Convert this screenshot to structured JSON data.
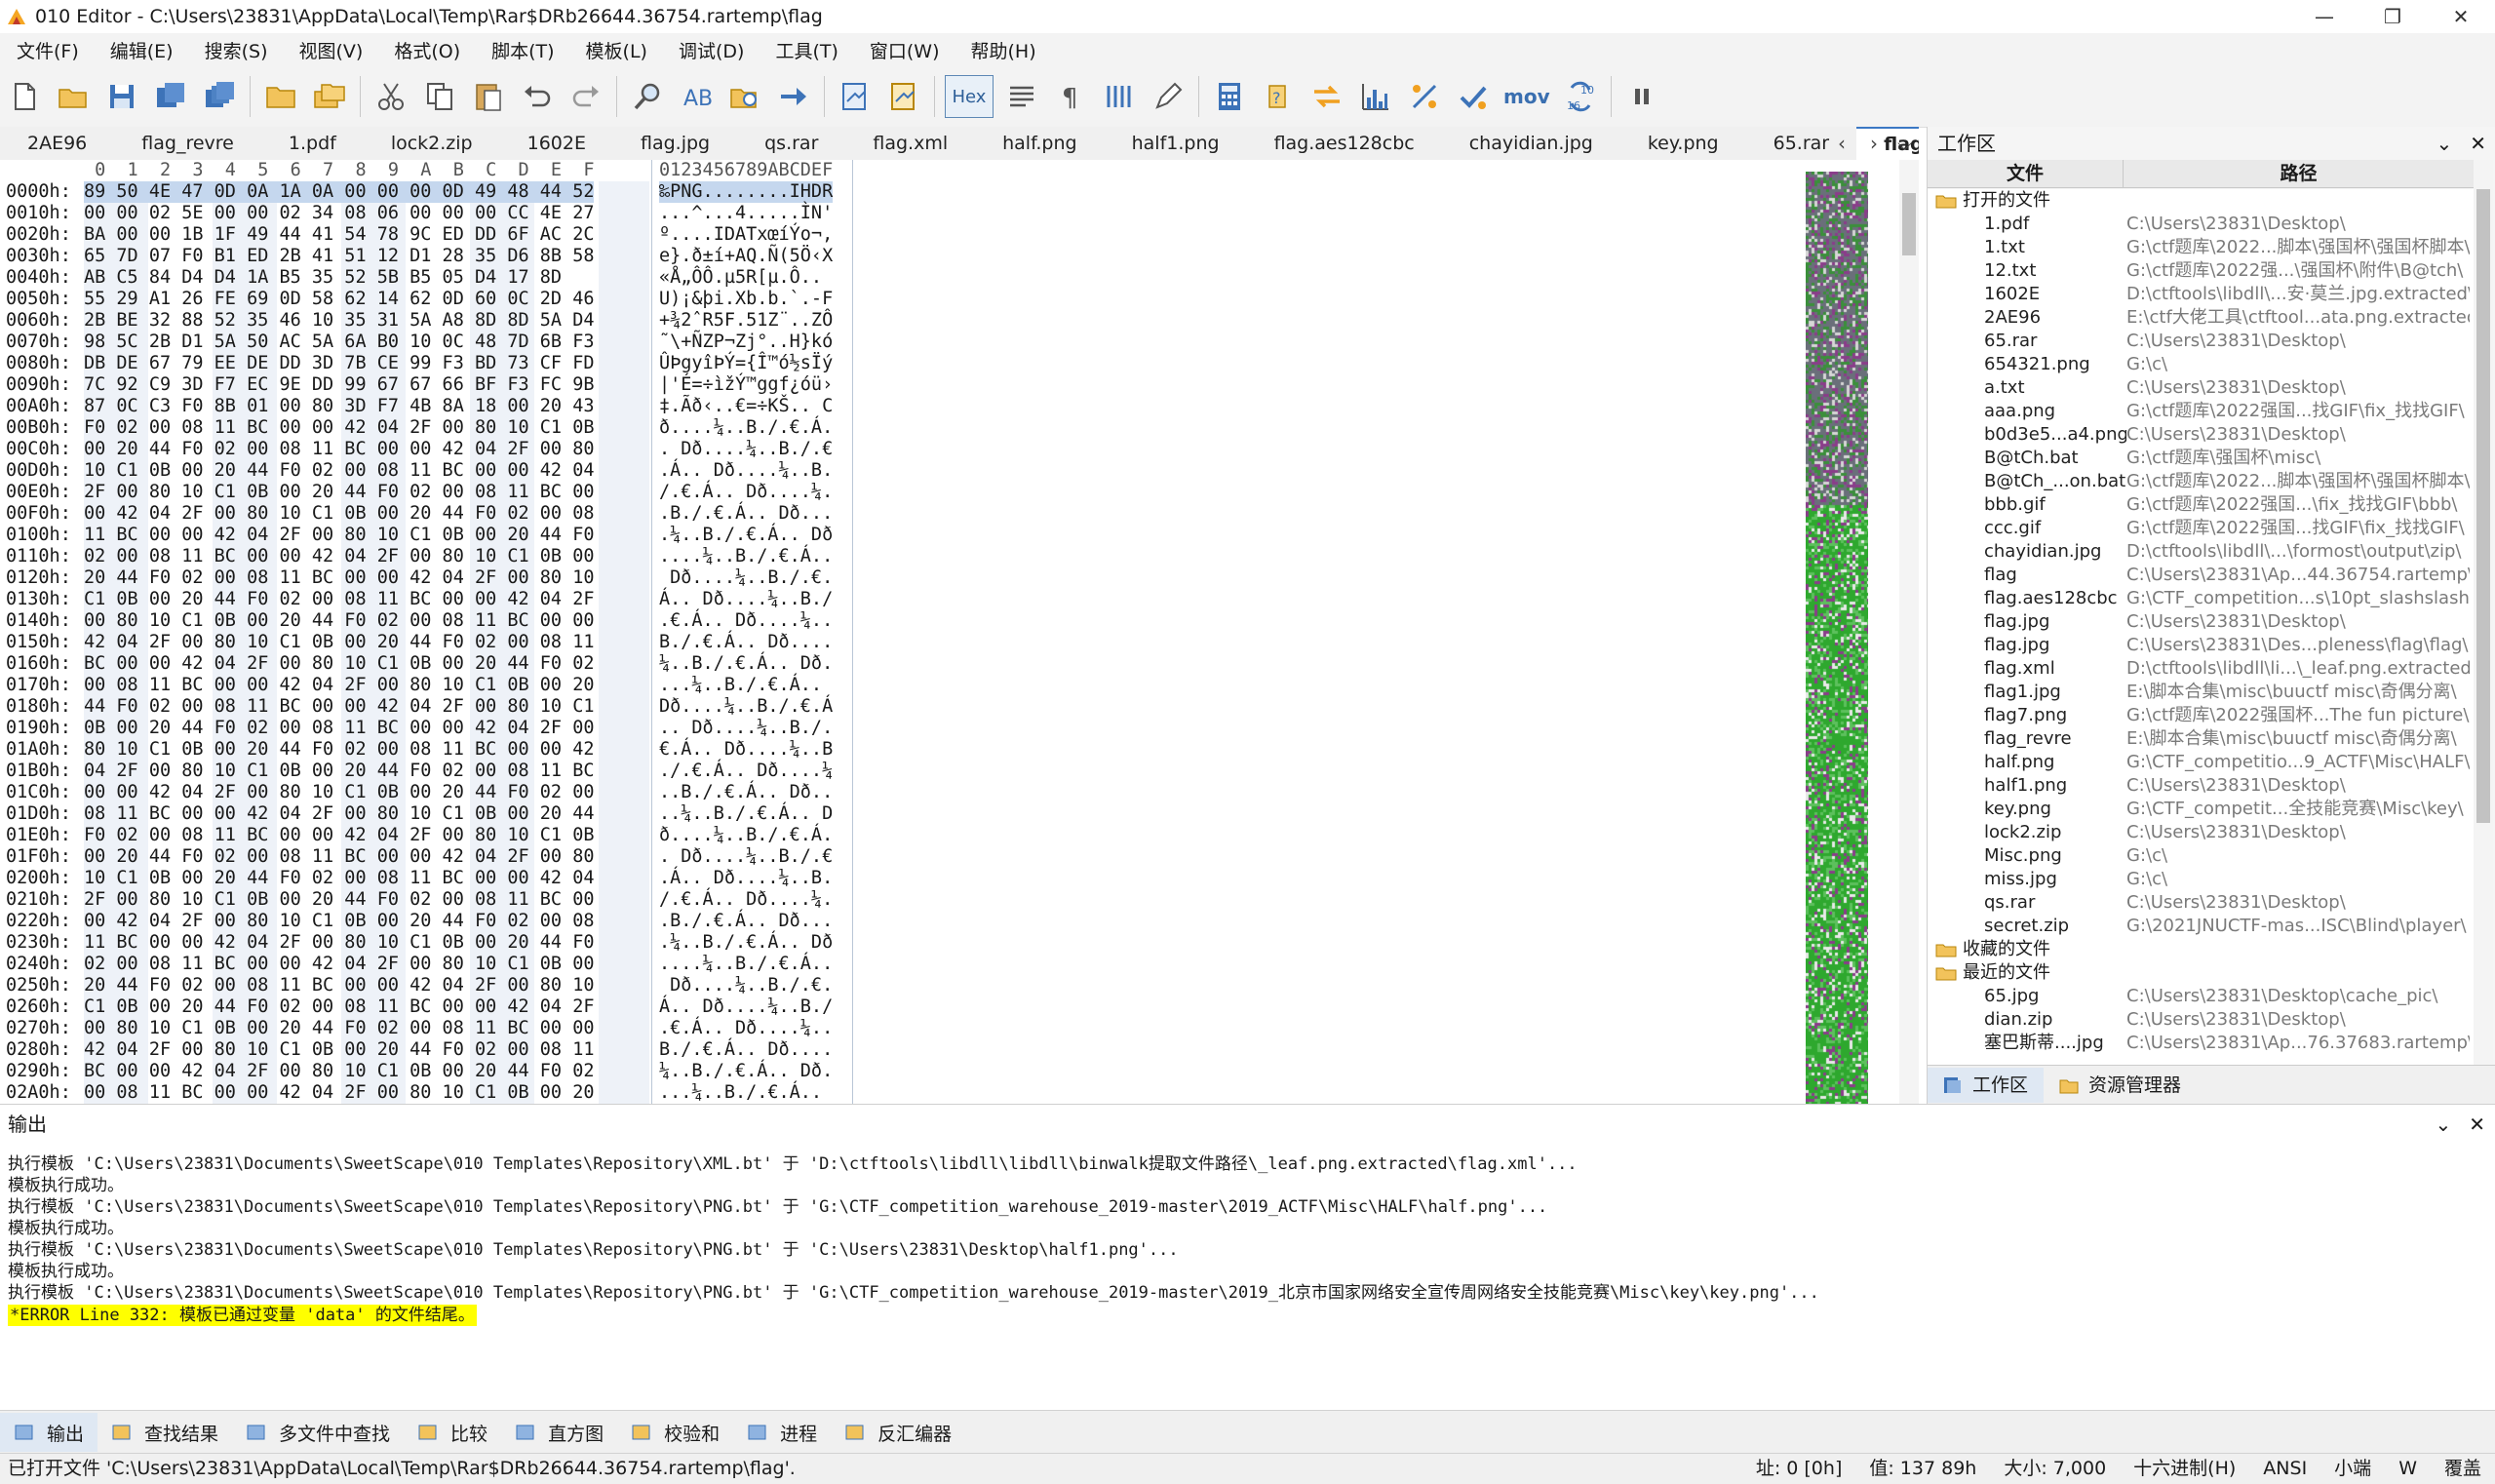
{
  "titlebar": {
    "title": "010 Editor - C:\\Users\\23831\\AppData\\Local\\Temp\\Rar$DRb26644.36754.rartemp\\flag",
    "minimize": "—",
    "maximize": "❐",
    "close": "✕"
  },
  "menu": [
    "文件(F)",
    "编辑(E)",
    "搜索(S)",
    "视图(V)",
    "格式(O)",
    "脚本(T)",
    "模板(L)",
    "调试(D)",
    "工具(T)",
    "窗口(W)",
    "帮助(H)"
  ],
  "toolbar": {
    "hex_label": "Hex",
    "mov_label": "mov",
    "b1": "10",
    "b2": "16"
  },
  "tabs": [
    "2AE96",
    "flag_revre",
    "1.pdf",
    "lock2.zip",
    "1602E",
    "flag.jpg",
    "qs.rar",
    "flag.xml",
    "half.png",
    "half1.png",
    "flag.aes128cbc",
    "chayidian.jpg",
    "key.png",
    "65.rar"
  ],
  "active_tab": {
    "label": "flag",
    "close": "✕"
  },
  "tab_nav": {
    "prev": "‹",
    "next": "›",
    "list": "⌵"
  },
  "hex": {
    "header_offset": "",
    "header_hex": " 0  1  2  3  4  5  6  7  8  9  A  B  C  D  E  F",
    "header_ascii": "0123456789ABCDEF",
    "rows": [
      {
        "off": "0000h:",
        "hex": "89 50 4E 47 0D 0A 1A 0A 00 00 00 0D 49 48 44 52",
        "asc": "‰PNG........IHDR"
      },
      {
        "off": "0010h:",
        "hex": "00 00 02 5E 00 00 02 34 08 06 00 00 00 CC 4E 27",
        "asc": "...^...4.....ÌN'"
      },
      {
        "off": "0020h:",
        "hex": "BA 00 00 1B 1F 49 44 41 54 78 9C ED DD 6F AC 2C",
        "asc": "º....IDATxœíÝo¬,"
      },
      {
        "off": "0030h:",
        "hex": "65 7D 07 F0 B1 ED 2B 41 51 12 D1 28 35 D6 8B 58",
        "asc": "e}.ð±í+AQ.Ñ(5Ö‹X"
      },
      {
        "off": "0040h:",
        "hex": "AB C5 84 D4 D4 1A B5 35 52 5B B5 05 D4 17 8D",
        "asc": "«Å„ÔÔ.µ5R[µ.Ô.."
      },
      {
        "off": "0050h:",
        "hex": "55 29 A1 26 FE 69 0D 58 62 14 62 0D 60 0C 2D 46",
        "asc": "U)¡&þi.Xb.b.`.-F"
      },
      {
        "off": "0060h:",
        "hex": "2B BE 32 88 52 35 46 10 35 31 5A A8 8D 8D 5A D4",
        "asc": "+¾2ˆR5F.51Z¨..ZÔ"
      },
      {
        "off": "0070h:",
        "hex": "98 5C 2B D1 5A 50 AC 5A 6A B0 10 0C 48 7D 6B F3",
        "asc": "˜\\+ÑZP¬Zj°..H}kó"
      },
      {
        "off": "0080h:",
        "hex": "DB DE 67 79 EE DE DD 3D 7B CE 99 F3 BD 73 CF FD",
        "asc": "ÛÞgyîÞÝ={Î™ó½sÏý"
      },
      {
        "off": "0090h:",
        "hex": "7C 92 C9 3D F7 EC 9E DD 99 67 67 66 BF F3 FC 9B",
        "asc": "|'É=÷ìžÝ™ggf¿óü›"
      },
      {
        "off": "00A0h:",
        "hex": "87 0C C3 F0 8B 01 00 80 3D F7 4B 8A 18 00 20 43",
        "asc": "‡.Ãð‹..€=÷KŠ.. C"
      },
      {
        "off": "00B0h:",
        "hex": "F0 02 00 08 11 BC 00 00 42 04 2F 00 80 10 C1 0B",
        "asc": "ð....¼..B./.€.Á."
      },
      {
        "off": "00C0h:",
        "hex": "00 20 44 F0 02 00 08 11 BC 00 00 42 04 2F 00 80",
        "asc": ". Dð....¼..B./.€"
      },
      {
        "off": "00D0h:",
        "hex": "10 C1 0B 00 20 44 F0 02 00 08 11 BC 00 00 42 04",
        "asc": ".Á.. Dð....¼..B."
      },
      {
        "off": "00E0h:",
        "hex": "2F 00 80 10 C1 0B 00 20 44 F0 02 00 08 11 BC 00",
        "asc": "/.€.Á.. Dð....¼."
      },
      {
        "off": "00F0h:",
        "hex": "00 42 04 2F 00 80 10 C1 0B 00 20 44 F0 02 00 08",
        "asc": ".B./.€.Á.. Dð..."
      },
      {
        "off": "0100h:",
        "hex": "11 BC 00 00 42 04 2F 00 80 10 C1 0B 00 20 44 F0",
        "asc": ".¼..B./.€.Á.. Dð"
      },
      {
        "off": "0110h:",
        "hex": "02 00 08 11 BC 00 00 42 04 2F 00 80 10 C1 0B 00",
        "asc": "....¼..B./.€.Á.."
      },
      {
        "off": "0120h:",
        "hex": "20 44 F0 02 00 08 11 BC 00 00 42 04 2F 00 80 10",
        "asc": " Dð....¼..B./.€."
      },
      {
        "off": "0130h:",
        "hex": "C1 0B 00 20 44 F0 02 00 08 11 BC 00 00 42 04 2F",
        "asc": "Á.. Dð....¼..B./"
      },
      {
        "off": "0140h:",
        "hex": "00 80 10 C1 0B 00 20 44 F0 02 00 08 11 BC 00 00",
        "asc": ".€.Á.. Dð....¼.."
      },
      {
        "off": "0150h:",
        "hex": "42 04 2F 00 80 10 C1 0B 00 20 44 F0 02 00 08 11",
        "asc": "B./.€.Á.. Dð...."
      },
      {
        "off": "0160h:",
        "hex": "BC 00 00 42 04 2F 00 80 10 C1 0B 00 20 44 F0 02",
        "asc": "¼..B./.€.Á.. Dð."
      },
      {
        "off": "0170h:",
        "hex": "00 08 11 BC 00 00 42 04 2F 00 80 10 C1 0B 00 20",
        "asc": "...¼..B./.€.Á.. "
      },
      {
        "off": "0180h:",
        "hex": "44 F0 02 00 08 11 BC 00 00 42 04 2F 00 80 10 C1",
        "asc": "Dð....¼..B./.€.Á"
      },
      {
        "off": "0190h:",
        "hex": "0B 00 20 44 F0 02 00 08 11 BC 00 00 42 04 2F 00",
        "asc": ".. Dð....¼..B./."
      },
      {
        "off": "01A0h:",
        "hex": "80 10 C1 0B 00 20 44 F0 02 00 08 11 BC 00 00 42",
        "asc": "€.Á.. Dð....¼..B"
      },
      {
        "off": "01B0h:",
        "hex": "04 2F 00 80 10 C1 0B 00 20 44 F0 02 00 08 11 BC",
        "asc": "./.€.Á.. Dð....¼"
      },
      {
        "off": "01C0h:",
        "hex": "00 00 42 04 2F 00 80 10 C1 0B 00 20 44 F0 02 00",
        "asc": "..B./.€.Á.. Dð.."
      },
      {
        "off": "01D0h:",
        "hex": "08 11 BC 00 00 42 04 2F 00 80 10 C1 0B 00 20 44",
        "asc": "..¼..B./.€.Á.. D"
      },
      {
        "off": "01E0h:",
        "hex": "F0 02 00 08 11 BC 00 00 42 04 2F 00 80 10 C1 0B",
        "asc": "ð....¼..B./.€.Á."
      },
      {
        "off": "01F0h:",
        "hex": "00 20 44 F0 02 00 08 11 BC 00 00 42 04 2F 00 80",
        "asc": ". Dð....¼..B./.€"
      },
      {
        "off": "0200h:",
        "hex": "10 C1 0B 00 20 44 F0 02 00 08 11 BC 00 00 42 04",
        "asc": ".Á.. Dð....¼..B."
      },
      {
        "off": "0210h:",
        "hex": "2F 00 80 10 C1 0B 00 20 44 F0 02 00 08 11 BC 00",
        "asc": "/.€.Á.. Dð....¼."
      },
      {
        "off": "0220h:",
        "hex": "00 42 04 2F 00 80 10 C1 0B 00 20 44 F0 02 00 08",
        "asc": ".B./.€.Á.. Dð..."
      },
      {
        "off": "0230h:",
        "hex": "11 BC 00 00 42 04 2F 00 80 10 C1 0B 00 20 44 F0",
        "asc": ".¼..B./.€.Á.. Dð"
      },
      {
        "off": "0240h:",
        "hex": "02 00 08 11 BC 00 00 42 04 2F 00 80 10 C1 0B 00",
        "asc": "....¼..B./.€.Á.."
      },
      {
        "off": "0250h:",
        "hex": "20 44 F0 02 00 08 11 BC 00 00 42 04 2F 00 80 10",
        "asc": " Dð....¼..B./.€."
      },
      {
        "off": "0260h:",
        "hex": "C1 0B 00 20 44 F0 02 00 08 11 BC 00 00 42 04 2F",
        "asc": "Á.. Dð....¼..B./"
      },
      {
        "off": "0270h:",
        "hex": "00 80 10 C1 0B 00 20 44 F0 02 00 08 11 BC 00 00",
        "asc": ".€.Á.. Dð....¼.."
      },
      {
        "off": "0280h:",
        "hex": "42 04 2F 00 80 10 C1 0B 00 20 44 F0 02 00 08 11",
        "asc": "B./.€.Á.. Dð...."
      },
      {
        "off": "0290h:",
        "hex": "BC 00 00 42 04 2F 00 80 10 C1 0B 00 20 44 F0 02",
        "asc": "¼..B./.€.Á.. Dð."
      },
      {
        "off": "02A0h:",
        "hex": "00 08 11 BC 00 00 42 04 2F 00 80 10 C1 0B 00 20",
        "asc": "...¼..B./.€.Á.. "
      }
    ]
  },
  "workspace": {
    "title": "工作区",
    "pin": "⌄",
    "close": "✕",
    "col_file": "文件",
    "col_path": "路径",
    "group_open": "打开的文件",
    "open_files": [
      {
        "name": "1.pdf",
        "path": "C:\\Users\\23831\\Desktop\\"
      },
      {
        "name": "1.txt",
        "path": "G:\\ctf题库\\2022...脚本\\强国杯\\强国杯脚本\\"
      },
      {
        "name": "12.txt",
        "path": "G:\\ctf题库\\2022强...\\强国杯\\附件\\B@tch\\"
      },
      {
        "name": "1602E",
        "path": "D:\\ctftools\\libdll\\...安·莫兰.jpg.extracted\\"
      },
      {
        "name": "2AE96",
        "path": "E:\\ctf大佬工具\\ctftool...ata.png.extracted\\"
      },
      {
        "name": "65.rar",
        "path": "C:\\Users\\23831\\Desktop\\"
      },
      {
        "name": "654321.png",
        "path": "G:\\c\\"
      },
      {
        "name": "a.txt",
        "path": "C:\\Users\\23831\\Desktop\\"
      },
      {
        "name": "aaa.png",
        "path": "G:\\ctf题库\\2022强国...找GIF\\fix_找找GIF\\"
      },
      {
        "name": "b0d3e5...a4.png",
        "path": "C:\\Users\\23831\\Desktop\\"
      },
      {
        "name": "B@tCh.bat",
        "path": "G:\\ctf题库\\强国杯\\misc\\"
      },
      {
        "name": "B@tCh_...on.bat",
        "path": "G:\\ctf题库\\2022...脚本\\强国杯\\强国杯脚本\\"
      },
      {
        "name": "bbb.gif",
        "path": "G:\\ctf题库\\2022强国...\\fix_找找GIF\\bbb\\"
      },
      {
        "name": "ccc.gif",
        "path": "G:\\ctf题库\\2022强国...找GIF\\fix_找找GIF\\"
      },
      {
        "name": "chayidian.jpg",
        "path": "D:\\ctftools\\libdll\\...\\formost\\output\\zip\\"
      },
      {
        "name": "flag",
        "path": "C:\\Users\\23831\\Ap...44.36754.rartemp\\"
      },
      {
        "name": "flag.aes128cbc",
        "path": "G:\\CTF_competition...s\\10pt_slashslash\\"
      },
      {
        "name": "flag.jpg",
        "path": "C:\\Users\\23831\\Desktop\\"
      },
      {
        "name": "flag.jpg",
        "path": "C:\\Users\\23831\\Des...pleness\\flag\\flag\\"
      },
      {
        "name": "flag.xml",
        "path": "D:\\ctftools\\libdll\\li...\\_leaf.png.extracted\\"
      },
      {
        "name": "flag1.jpg",
        "path": "E:\\脚本合集\\misc\\buuctf misc\\奇偶分离\\"
      },
      {
        "name": "flag7.png",
        "path": "G:\\ctf题库\\2022强国杯...The fun picture\\"
      },
      {
        "name": "flag_revre",
        "path": "E:\\脚本合集\\misc\\buuctf misc\\奇偶分离\\"
      },
      {
        "name": "half.png",
        "path": "G:\\CTF_competitio...9_ACTF\\Misc\\HALF\\"
      },
      {
        "name": "half1.png",
        "path": "C:\\Users\\23831\\Desktop\\"
      },
      {
        "name": "key.png",
        "path": "G:\\CTF_competit...全技能竞赛\\Misc\\key\\"
      },
      {
        "name": "lock2.zip",
        "path": "C:\\Users\\23831\\Desktop\\"
      },
      {
        "name": "Misc.png",
        "path": "G:\\c\\"
      },
      {
        "name": "miss.jpg",
        "path": "G:\\c\\"
      },
      {
        "name": "qs.rar",
        "path": "C:\\Users\\23831\\Desktop\\"
      },
      {
        "name": "secret.zip",
        "path": "G:\\2021JNUCTF-mas...ISC\\Blind\\player\\"
      }
    ],
    "group_fav": "收藏的文件",
    "group_recent": "最近的文件",
    "recent_files": [
      {
        "name": "65.jpg",
        "path": "C:\\Users\\23831\\Desktop\\cache_pic\\"
      },
      {
        "name": "dian.zip",
        "path": "C:\\Users\\23831\\Desktop\\"
      },
      {
        "name": "塞巴斯蒂....jpg",
        "path": "C:\\Users\\23831\\Ap...76.37683.rartemp\\"
      }
    ],
    "tab_workspace": "工作区",
    "tab_explorer": "资源管理器"
  },
  "output": {
    "title": "输出",
    "pin": "⌄",
    "close": "✕",
    "lines": [
      "执行模板 'C:\\Users\\23831\\Documents\\SweetScape\\010 Templates\\Repository\\XML.bt' 于 'D:\\ctftools\\libdll\\libdll\\binwalk提取文件路径\\_leaf.png.extracted\\flag.xml'...",
      "模板执行成功。",
      "执行模板 'C:\\Users\\23831\\Documents\\SweetScape\\010 Templates\\Repository\\PNG.bt' 于 'G:\\CTF_competition_warehouse_2019-master\\2019_ACTF\\Misc\\HALF\\half.png'...",
      "模板执行成功。",
      "执行模板 'C:\\Users\\23831\\Documents\\SweetScape\\010 Templates\\Repository\\PNG.bt' 于 'C:\\Users\\23831\\Desktop\\half1.png'...",
      "模板执行成功。",
      "执行模板 'C:\\Users\\23831\\Documents\\SweetScape\\010 Templates\\Repository\\PNG.bt' 于 'G:\\CTF_competition_warehouse_2019-master\\2019_北京市国家网络安全宣传周网络安全技能竞赛\\Misc\\key\\key.png'..."
    ],
    "error": "*ERROR Line 332: 模板已通过变量 'data' 的文件结尾。"
  },
  "bottom_tabs": [
    "输出",
    "查找结果",
    "多文件中查找",
    "比较",
    "直方图",
    "校验和",
    "进程",
    "反汇编器"
  ],
  "status": {
    "left": "已打开文件 'C:\\Users\\23831\\AppData\\Local\\Temp\\Rar$DRb26644.36754.rartemp\\flag'.",
    "addr": "址: 0 [0h]",
    "value": "值: 137 89h",
    "size": "大小: 7,000",
    "mode": "十六进制(H)",
    "enc": "ANSI",
    "endian": "小端",
    "w": "W",
    "ovr": "覆盖"
  },
  "colors": {
    "accent": "#3b78c4",
    "error_bg": "#ffff00",
    "selection": "#c5d7ee",
    "bytemap_green": "#2ea82e",
    "bytemap_purple": "#8a3d8a"
  }
}
